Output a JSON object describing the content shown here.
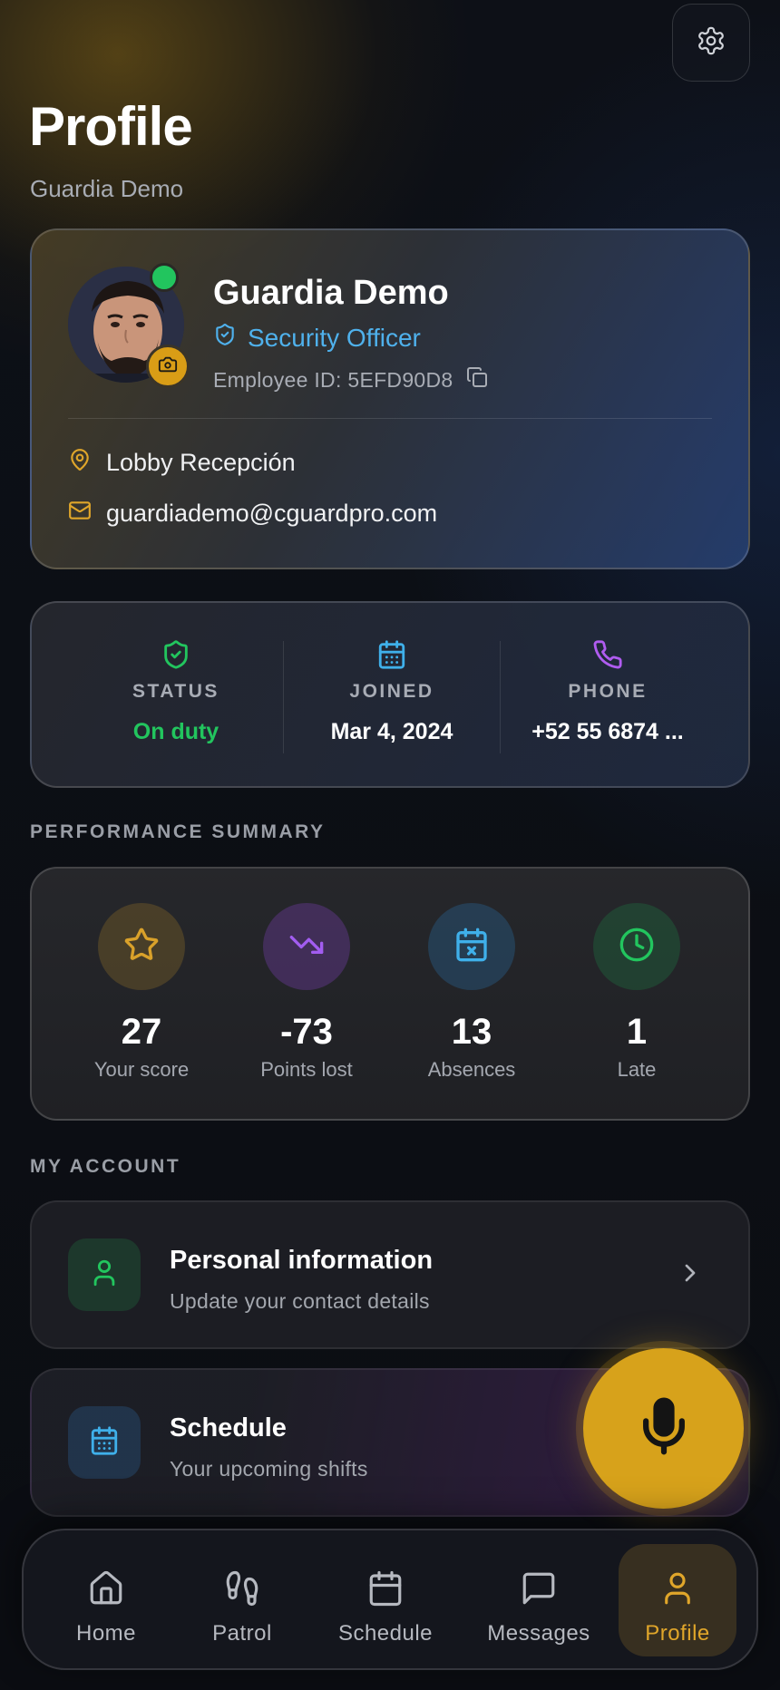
{
  "header": {
    "title": "Profile",
    "subtitle": "Guardia Demo",
    "settings_icon": "gear-icon"
  },
  "profile": {
    "name": "Guardia Demo",
    "role": "Security Officer",
    "employee_id": "Employee ID: 5EFD90D8",
    "location": "Lobby Recepción",
    "email": "guardiademo@cguardpro.com",
    "online_color": "#22c55e"
  },
  "stats": [
    {
      "label": "STATUS",
      "value": "On duty",
      "icon": "shield-check-icon",
      "color": "#22c55e"
    },
    {
      "label": "JOINED",
      "value": "Mar 4, 2024",
      "icon": "calendar-icon",
      "color": "#3fb0ea"
    },
    {
      "label": "PHONE",
      "value": "+52 55 6874 ...",
      "icon": "phone-icon",
      "color": "#b05cf0"
    }
  ],
  "performance": {
    "section_label": "PERFORMANCE SUMMARY",
    "items": [
      {
        "value": "27",
        "label": "Your score",
        "icon": "star-icon",
        "color": "#d9a12a"
      },
      {
        "value": "-73",
        "label": "Points lost",
        "icon": "trending-down-icon",
        "color": "#a25df0"
      },
      {
        "value": "13",
        "label": "Absences",
        "icon": "calendar-x-icon",
        "color": "#3fb0ea"
      },
      {
        "value": "1",
        "label": "Late",
        "icon": "clock-icon",
        "color": "#22c55e"
      }
    ]
  },
  "account": {
    "section_label": "MY ACCOUNT",
    "items": [
      {
        "title": "Personal information",
        "desc": "Update your contact details",
        "icon": "user-icon"
      },
      {
        "title": "Schedule",
        "desc": "Your upcoming shifts",
        "icon": "calendar-icon"
      }
    ]
  },
  "fab": {
    "icon": "microphone-icon",
    "color": "#d7a21b"
  },
  "tabs": [
    {
      "label": "Home",
      "icon": "home-icon"
    },
    {
      "label": "Patrol",
      "icon": "footprints-icon"
    },
    {
      "label": "Schedule",
      "icon": "calendar-icon"
    },
    {
      "label": "Messages",
      "icon": "message-icon"
    },
    {
      "label": "Profile",
      "icon": "user-icon",
      "active": true
    }
  ]
}
